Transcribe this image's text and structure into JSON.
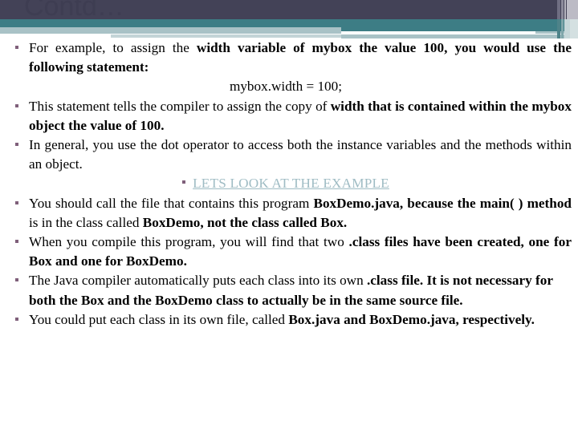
{
  "slide": {
    "title": "Contd…",
    "colors": {
      "header_dark": "#434257",
      "header_teal": "#3d7d85",
      "header_pale": "#a9c2c6",
      "bullet_marker": "#7f5f7a",
      "hyperlink": "#9fbcc4",
      "body_text": "#000000",
      "background": "#ffffff"
    },
    "bullets": [
      {
        "id": "bullet-for-example",
        "segments": [
          {
            "text": "For example, to assign the ",
            "bold": false
          },
          {
            "text": "width variable of mybox the value 100, you would use the following statement:",
            "bold": true
          }
        ]
      },
      {
        "id": "bullet-this-statement",
        "segments": [
          {
            "text": "This statement tells the compiler to assign the copy of ",
            "bold": false
          },
          {
            "text": "width that is contained within the mybox object the value of 100.",
            "bold": true
          }
        ]
      },
      {
        "id": "bullet-in-general",
        "segments": [
          {
            "text": "In general, you use the dot operator to access both the instance variables and the methods within an object.",
            "bold": false
          }
        ]
      },
      {
        "id": "bullet-you-should-call",
        "segments": [
          {
            "text": "You should call the file that contains this program ",
            "bold": false
          },
          {
            "text": "BoxDemo.java, because the main( ) method ",
            "bold": true
          },
          {
            "text": "is in the class called ",
            "bold": false
          },
          {
            "text": "BoxDemo, not the class called Box.",
            "bold": true
          }
        ]
      },
      {
        "id": "bullet-when-you-compile",
        "segments": [
          {
            "text": "When you compile this program, you will find that two ",
            "bold": false
          },
          {
            "text": ".class files have been created, one for Box and one for BoxDemo.",
            "bold": true
          }
        ]
      },
      {
        "id": "bullet-java-compiler",
        "segments": [
          {
            "text": "The Java compiler automatically puts each class into its own ",
            "bold": false
          },
          {
            "text": ".class file. It is not necessary for both the Box and the BoxDemo class to actually be in the same source file.",
            "bold": true
          }
        ]
      },
      {
        "id": "bullet-you-could-put",
        "segments": [
          {
            "text": "You could put each class in its own file, called ",
            "bold": false
          },
          {
            "text": "Box.java and BoxDemo.java,",
            "bold": true
          },
          {
            "text": " respectively.",
            "bold": true
          }
        ]
      }
    ],
    "code_line": "mybox.width = 100;",
    "example_link": "LETS LOOK AT THE EXAMPLE"
  }
}
